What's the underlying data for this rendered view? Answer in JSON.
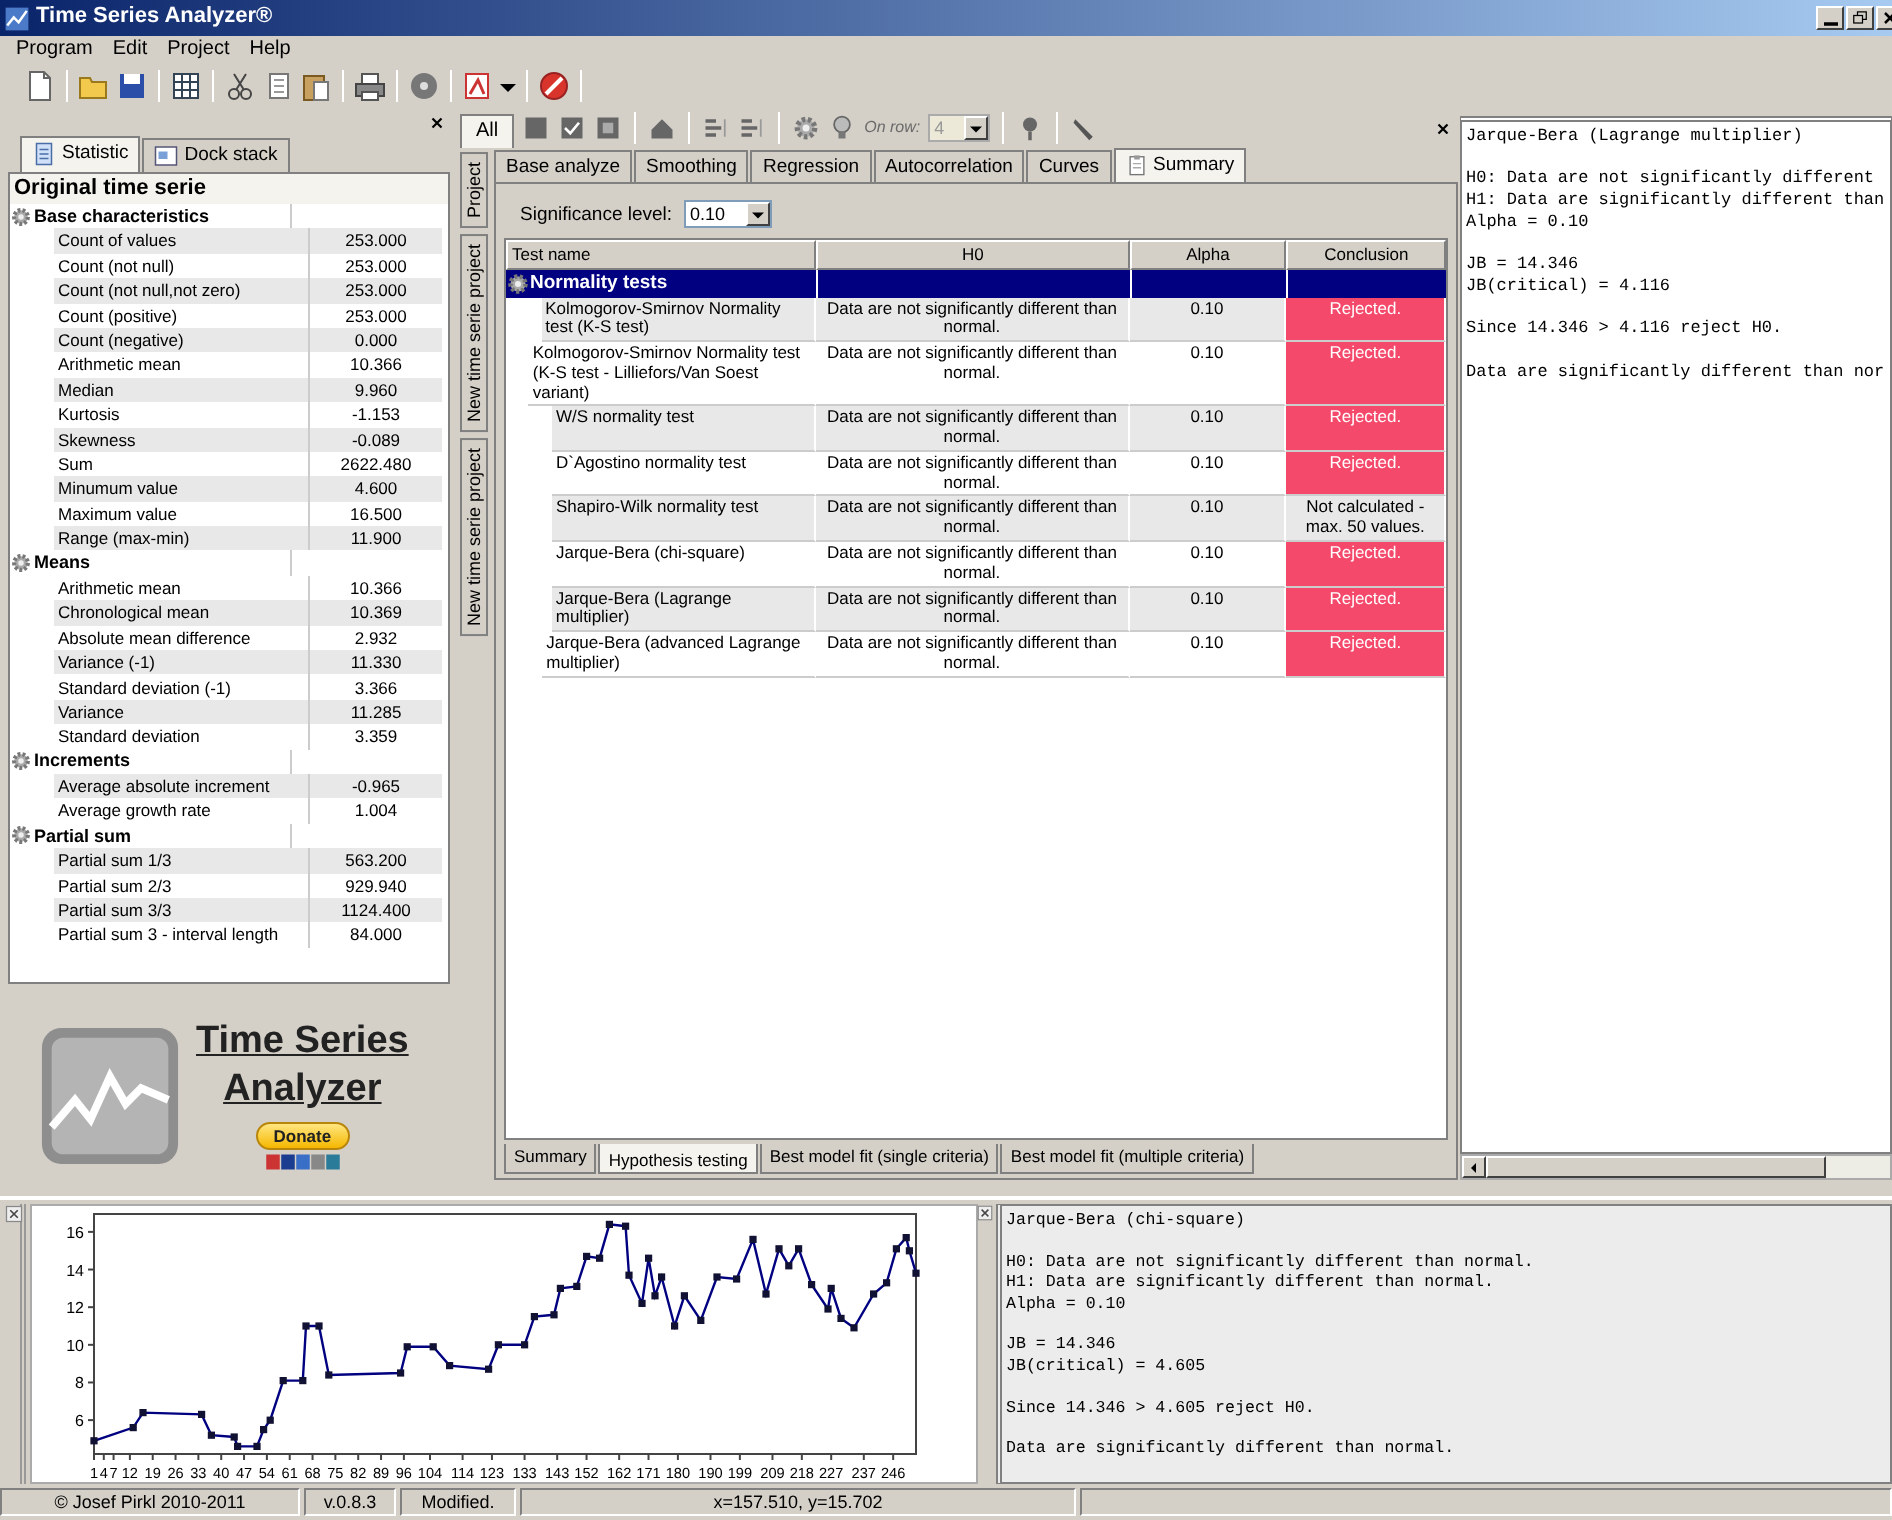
{
  "window": {
    "title": "Time Series Analyzer®"
  },
  "menu": [
    "Program",
    "Edit",
    "Project",
    "Help"
  ],
  "left_panel": {
    "tabs": [
      {
        "label": "Statistic",
        "selected": true
      },
      {
        "label": "Dock stack",
        "selected": false
      }
    ],
    "heading": "Original time serie",
    "groups": [
      {
        "name": "Base characteristics",
        "rows": [
          {
            "name": "Count of values",
            "value": "253.000"
          },
          {
            "name": "Count (not null)",
            "value": "253.000"
          },
          {
            "name": "Count (not null,not zero)",
            "value": "253.000"
          },
          {
            "name": "Count (positive)",
            "value": "253.000"
          },
          {
            "name": "Count (negative)",
            "value": "0.000"
          },
          {
            "name": "Arithmetic mean",
            "value": "10.366"
          },
          {
            "name": "Median",
            "value": "9.960"
          },
          {
            "name": "Kurtosis",
            "value": "-1.153"
          },
          {
            "name": "Skewness",
            "value": "-0.089"
          },
          {
            "name": "Sum",
            "value": "2622.480"
          },
          {
            "name": "Minumum value",
            "value": "4.600"
          },
          {
            "name": "Maximum value",
            "value": "16.500"
          },
          {
            "name": "Range (max-min)",
            "value": "11.900"
          }
        ]
      },
      {
        "name": "Means",
        "rows": [
          {
            "name": "Arithmetic mean",
            "value": "10.366"
          },
          {
            "name": "Chronological mean",
            "value": "10.369"
          },
          {
            "name": "Absolute mean difference",
            "value": "2.932"
          },
          {
            "name": "Variance (-1)",
            "value": "11.330"
          },
          {
            "name": "Standard deviation (-1)",
            "value": "3.366"
          },
          {
            "name": "Variance",
            "value": "11.285"
          },
          {
            "name": "Standard deviation",
            "value": "3.359"
          }
        ]
      },
      {
        "name": "Increments",
        "rows": [
          {
            "name": "Average absolute increment",
            "value": "-0.965"
          },
          {
            "name": "Average growth rate",
            "value": "1.004"
          }
        ]
      },
      {
        "name": "Partial sum",
        "rows": [
          {
            "name": "Partial sum 1/3",
            "value": "563.200"
          },
          {
            "name": "Partial sum 2/3",
            "value": "929.940"
          },
          {
            "name": "Partial sum 3/3",
            "value": "1124.400"
          },
          {
            "name": "Partial sum 3 - interval length",
            "value": "84.000"
          }
        ]
      }
    ]
  },
  "logo": {
    "title_lines": [
      "Time Series",
      "Analyzer"
    ],
    "donate": "Donate"
  },
  "center": {
    "toolbar": {
      "all_tab": "All",
      "on_row_label": "On row:",
      "on_row_value": "4",
      "on_row_disabled": true
    },
    "side_tabs": [
      "Project",
      "New time serie project",
      "New time serie project"
    ],
    "tabs": [
      {
        "label": "Base analyze",
        "selected": false,
        "with_icon": false
      },
      {
        "label": "Smoothing",
        "selected": false,
        "with_icon": false
      },
      {
        "label": "Regression",
        "selected": false,
        "with_icon": false
      },
      {
        "label": "Autocorrelation",
        "selected": false,
        "with_icon": false
      },
      {
        "label": "Curves",
        "selected": false,
        "with_icon": false
      },
      {
        "label": "Summary",
        "selected": true,
        "with_icon": true
      }
    ],
    "significance": {
      "label": "Significance level:",
      "value": "0.10"
    },
    "table": {
      "columns": [
        "Test name",
        "H0",
        "Alpha",
        "Conclusion"
      ],
      "group": "Normality tests",
      "rows": [
        {
          "test": "Kolmogorov-Smirnov Normality test (K-S test)",
          "h0": "Data are not significantly different than normal.",
          "alpha": "0.10",
          "conclusion": "Rejected.",
          "rejected": true
        },
        {
          "test": "Kolmogorov-Smirnov Normality test (K-S test - Lilliefors/Van Soest variant)",
          "h0": "Data are not significantly different than normal.",
          "alpha": "0.10",
          "conclusion": "Rejected.",
          "rejected": true
        },
        {
          "test": "W/S normality test",
          "h0": "Data are not significantly different than normal.",
          "alpha": "0.10",
          "conclusion": "Rejected.",
          "rejected": true
        },
        {
          "test": "D`Agostino normality test",
          "h0": "Data are not significantly different than normal.",
          "alpha": "0.10",
          "conclusion": "Rejected.",
          "rejected": true
        },
        {
          "test": "Shapiro-Wilk normality test",
          "h0": "Data are not significantly different than normal.",
          "alpha": "0.10",
          "conclusion": "Not calculated - max. 50 values.",
          "rejected": false
        },
        {
          "test": "Jarque-Bera (chi-square)",
          "h0": "Data are not significantly different than normal.",
          "alpha": "0.10",
          "conclusion": "Rejected.",
          "rejected": true
        },
        {
          "test": "Jarque-Bera (Lagrange multiplier)",
          "h0": "Data are not significantly different than normal.",
          "alpha": "0.10",
          "conclusion": "Rejected.",
          "rejected": true
        },
        {
          "test": "Jarque-Bera (advanced Lagrange multiplier)",
          "h0": "Data are not significantly different than normal.",
          "alpha": "0.10",
          "conclusion": "Rejected.",
          "rejected": true
        }
      ]
    },
    "bottom_tabs": [
      {
        "label": "Summary",
        "selected": false
      },
      {
        "label": "Hypothesis testing",
        "selected": true
      },
      {
        "label": "Best model fit (single criteria)",
        "selected": false
      },
      {
        "label": "Best model fit (multiple criteria)",
        "selected": false
      }
    ]
  },
  "right_output": {
    "blocks": [
      [
        "Jarque-Bera (Lagrange multiplier)"
      ],
      [
        "H0: Data are not significantly different",
        "H1: Data are significantly different than",
        "Alpha = 0.10"
      ],
      [
        "JB = 14.346",
        "JB(critical) = 4.116"
      ],
      [
        "Since 14.346 > 4.116 reject H0."
      ],
      [
        "Data are significantly different than nor"
      ]
    ]
  },
  "chart": {
    "chart_data": {
      "type": "line",
      "x": [
        1,
        13,
        16,
        34,
        37,
        44,
        45,
        51,
        53,
        55,
        59,
        65,
        66,
        70,
        73,
        95,
        97,
        105,
        110,
        122,
        125,
        133,
        136,
        142,
        144,
        149,
        152,
        156,
        159,
        164,
        165,
        169,
        171,
        173,
        175,
        179,
        182,
        187,
        192,
        198,
        203,
        207,
        211,
        214,
        217,
        221,
        226,
        227,
        230,
        234,
        240,
        244,
        247,
        250,
        251,
        253
      ],
      "series": [
        {
          "color": "#000080",
          "marker": "square",
          "values": [
            4.9,
            5.6,
            6.4,
            6.3,
            5.2,
            5.1,
            4.6,
            4.6,
            5.5,
            6.0,
            8.1,
            8.1,
            11.0,
            11.0,
            8.4,
            8.5,
            9.9,
            9.9,
            8.9,
            8.7,
            10.0,
            10.0,
            11.5,
            11.6,
            13.0,
            13.1,
            14.7,
            14.6,
            16.4,
            16.3,
            13.7,
            12.2,
            14.6,
            12.6,
            13.6,
            11.0,
            12.6,
            11.3,
            13.6,
            13.5,
            15.6,
            12.7,
            15.1,
            14.2,
            15.1,
            13.2,
            11.9,
            13.0,
            11.4,
            10.9,
            12.7,
            13.3,
            15.1,
            15.7,
            15.0,
            13.8
          ]
        }
      ],
      "xlim": [
        1,
        253
      ],
      "ylim": [
        4.2,
        16.95
      ],
      "xticks": [
        1,
        4,
        7,
        12,
        19,
        26,
        33,
        40,
        47,
        54,
        61,
        68,
        75,
        82,
        89,
        96,
        104,
        114,
        123,
        133,
        143,
        152,
        162,
        171,
        180,
        190,
        199,
        209,
        218,
        227,
        237,
        246
      ],
      "yticks": [
        6,
        8,
        10,
        12,
        14,
        16
      ]
    }
  },
  "bottom_output": {
    "blocks": [
      [
        "Jarque-Bera (chi-square)"
      ],
      [
        "H0: Data are not significantly different than normal.",
        "H1: Data are significantly different than normal.",
        "Alpha = 0.10"
      ],
      [
        "JB = 14.346",
        "JB(critical) = 4.605"
      ],
      [
        "Since 14.346 > 4.605 reject H0."
      ],
      [
        "Data are significantly different than normal."
      ]
    ]
  },
  "status_bar": [
    "© Josef Pirkl 2010-2011",
    "v.0.8.3",
    "Modified.",
    "x=157.510, y=15.702"
  ]
}
